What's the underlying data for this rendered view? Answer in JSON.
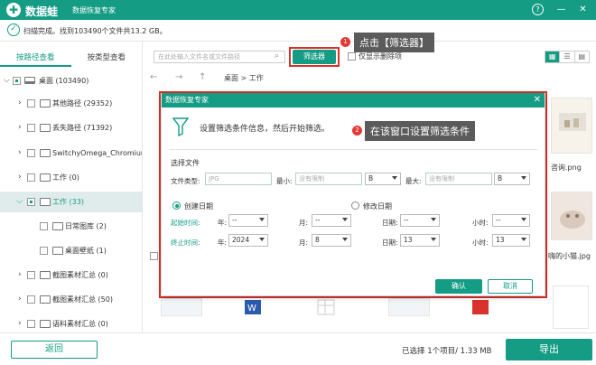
{
  "app": {
    "name": "数据蛙",
    "subtitle": "数据恢复专家",
    "help_icon": "question-icon"
  },
  "status": {
    "scan_text": "扫描完成。找到103490个文件共13.2 GB。"
  },
  "tabs": [
    {
      "label": "按路径查看",
      "active": true
    },
    {
      "label": "按类型查看",
      "active": false
    }
  ],
  "tree": [
    {
      "label": "桌面 (103490)"
    },
    {
      "label": "其他路径 (29352)"
    },
    {
      "label": "丢失路径 (71392)"
    },
    {
      "label": "SwitchyOmega_Chromium"
    },
    {
      "label": "工作 (0)"
    },
    {
      "label": "工作 (33)"
    },
    {
      "label": "日常图库 (2)"
    },
    {
      "label": "桌面壁纸 (1)"
    },
    {
      "label": "截图素材汇总 (0)"
    },
    {
      "label": "截图素材汇总 (50)"
    },
    {
      "label": "语料素材汇总 (0)"
    }
  ],
  "toolbar": {
    "search_placeholder": "在此处输入文件名或文件路径",
    "filter_label": "筛选器",
    "only_deleted_label": "仅显示删除项"
  },
  "nav": {
    "path": "桌面 > 工作"
  },
  "right_captions": {
    "c1": "咨询.png",
    "c2": "嗨的小猫.jpg"
  },
  "callouts": {
    "one_badge": "1",
    "one_text": "点击【筛选器】",
    "two_badge": "2",
    "two_text": "在该窗口设置筛选条件"
  },
  "dialog": {
    "title": "数据恢复专家",
    "hint": "设置筛选条件信息，然后开始筛选。",
    "section_file": "选择文件",
    "file_type_label": "文件类型:",
    "file_type_placeholder": "JPG",
    "min_label": "最小:",
    "min_placeholder": "没有限制",
    "min_unit": "B",
    "max_label": "最大:",
    "max_placeholder": "没有限制",
    "max_unit": "B",
    "create_date_label": "创建日期",
    "modify_date_label": "修改日期",
    "start_label": "起始时间:",
    "end_label": "终止时间:",
    "year_label": "年:",
    "month_label": "月:",
    "day_label": "日期:",
    "hour_label": "小时:",
    "start": {
      "year": "--",
      "month": "--",
      "day": "--",
      "hour": "--"
    },
    "end": {
      "year": "2024",
      "month": "8",
      "day": "13",
      "hour": "13"
    },
    "ok_label": "确认",
    "cancel_label": "取消"
  },
  "bottom": {
    "back_label": "返回",
    "selection_info": "已选择 1个项目/ 1.33 MB",
    "export_label": "导出"
  },
  "colors": {
    "accent": "#159c84",
    "highlight": "#d9312b",
    "callout_bg": "#5b5b5b"
  }
}
